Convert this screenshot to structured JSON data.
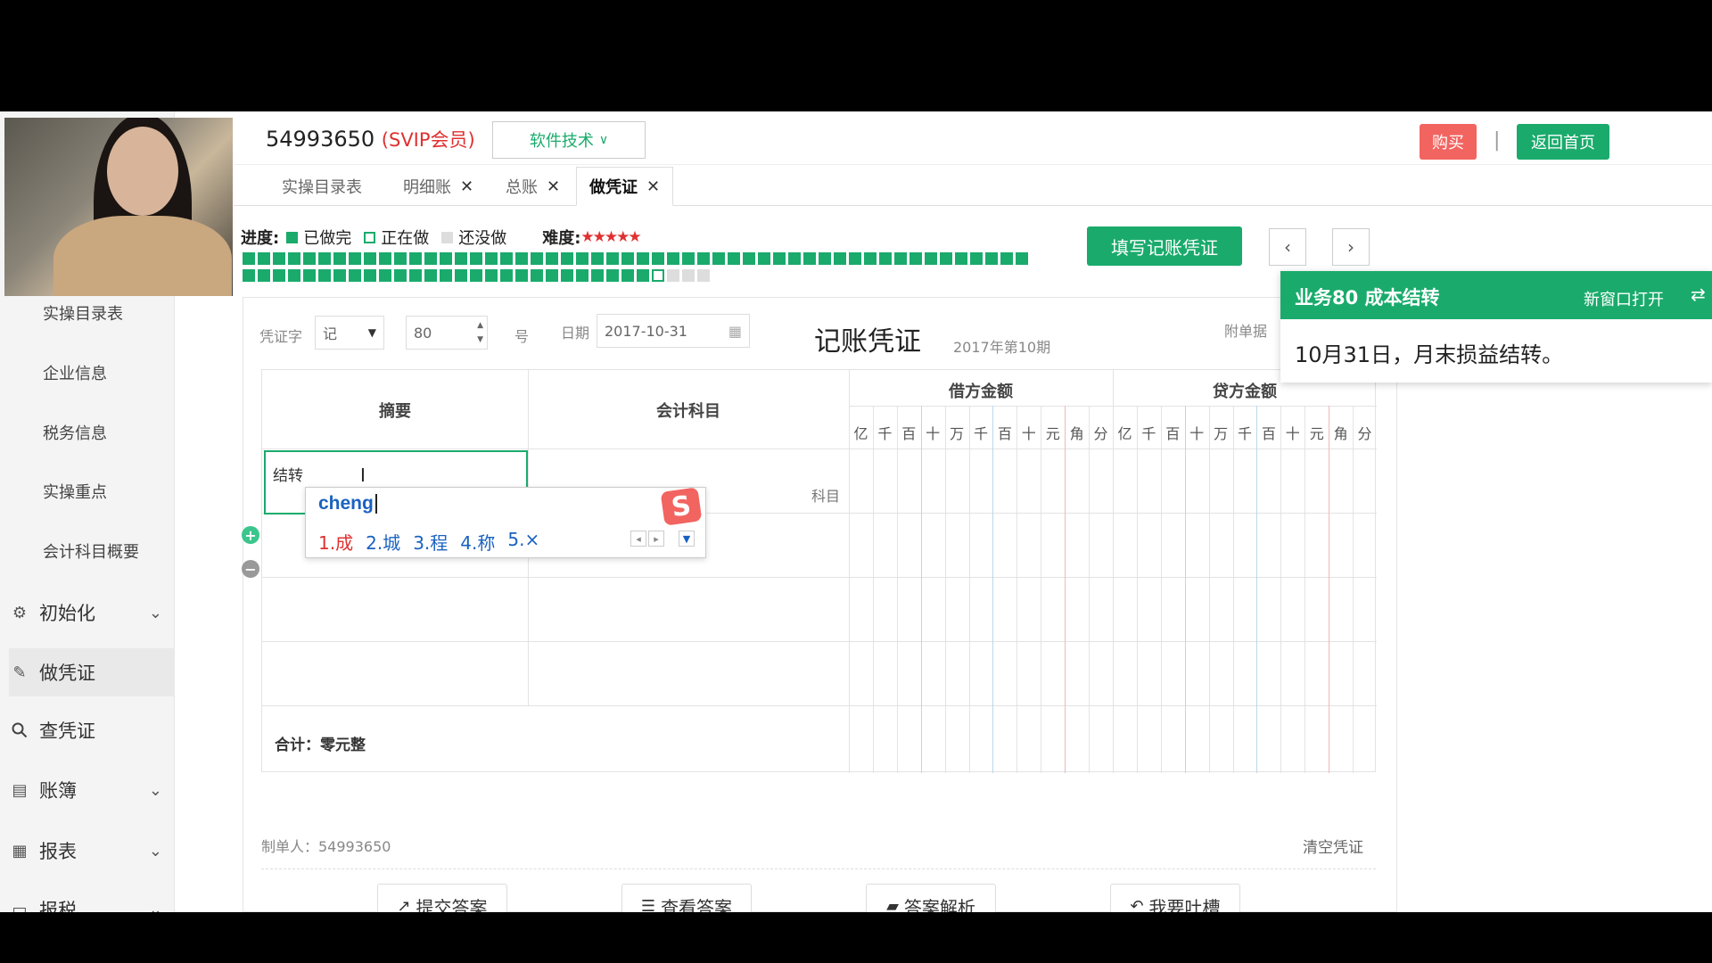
{
  "account": {
    "id": "54993650",
    "tier": "(SVIP会员)"
  },
  "header": {
    "software_btn": "软件技术",
    "buy": "购买",
    "separator": "|",
    "home": "返回首页"
  },
  "sidebar": {
    "sub_items": [
      "实操目录表",
      "企业信息",
      "税务信息",
      "实操重点",
      "会计科目概要"
    ],
    "main_items": [
      {
        "label": "初始化",
        "icon": "gear-icon",
        "expand": true
      },
      {
        "label": "做凭证",
        "icon": "pen-icon",
        "expand": false,
        "active": true
      },
      {
        "label": "查凭证",
        "icon": "search-icon",
        "expand": false
      },
      {
        "label": "账簿",
        "icon": "book-icon",
        "expand": true
      },
      {
        "label": "报表",
        "icon": "report-icon",
        "expand": true
      },
      {
        "label": "报税",
        "icon": "tax-icon",
        "expand": true
      }
    ]
  },
  "tabs": [
    {
      "label": "实操目录表",
      "closable": false
    },
    {
      "label": "明细账",
      "closable": true
    },
    {
      "label": "总账",
      "closable": true
    },
    {
      "label": "做凭证",
      "closable": true,
      "active": true
    }
  ],
  "progress": {
    "label": "进度:",
    "done": "已做完",
    "doing": "正在做",
    "todo": "还没做",
    "difficulty_label": "难度:",
    "difficulty_stars": 5,
    "done_count": 79,
    "doing_index": 80,
    "total": 83
  },
  "actions": {
    "fill_voucher": "填写记账凭证",
    "prev": "‹",
    "next": "›"
  },
  "voucher": {
    "word_label": "凭证字",
    "word_value": "记",
    "number": "80",
    "number_suffix": "号",
    "date_label": "日期",
    "date": "2017-10-31",
    "title": "记账凭证",
    "period": "2017年第10期",
    "attachment_label": "附单据",
    "col_summary": "摘要",
    "col_account": "会计科目",
    "col_debit": "借方金额",
    "col_credit": "贷方金额",
    "digits": [
      "亿",
      "千",
      "百",
      "十",
      "万",
      "千",
      "百",
      "十",
      "元",
      "角",
      "分"
    ],
    "row1_summary": "结转",
    "account_placeholder": "科目",
    "total": "合计：零元整",
    "maker": "制单人：54993650",
    "clear": "清空凭证"
  },
  "ime": {
    "input": "cheng",
    "candidates": [
      "1.成",
      "2.城",
      "3.程",
      "4.称",
      "5.×"
    ],
    "logo": "S"
  },
  "task": {
    "title": "业务80 成本结转",
    "open_new": "新窗口打开",
    "text": "10月31日，月末损益结转。"
  },
  "buttons": {
    "submit": "提交答案",
    "view": "查看答案",
    "analysis": "答案解析",
    "feedback": "我要吐槽"
  },
  "colors": {
    "primary": "#1aab6c",
    "danger": "#f26460",
    "star": "#e03030"
  }
}
